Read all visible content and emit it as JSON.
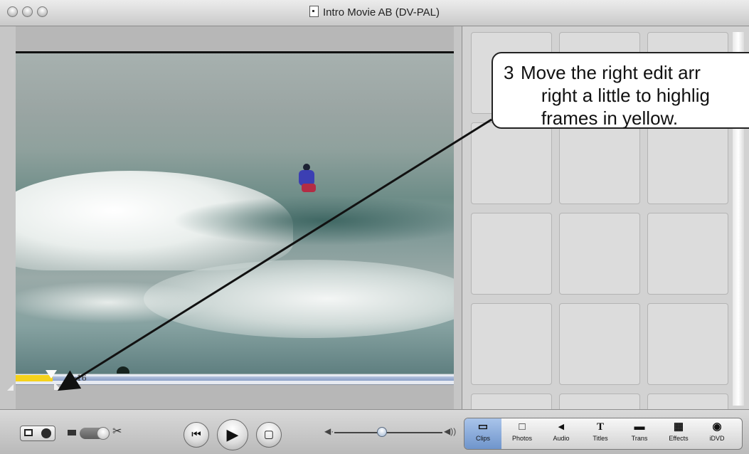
{
  "window": {
    "title": "Intro Movie AB (DV-PAL)"
  },
  "viewer": {
    "timecode": "0:16"
  },
  "callout": {
    "number": "3",
    "line1": "Move the right edit arr",
    "line2": "right a little to highlig",
    "line3": "frames in yellow."
  },
  "icons": {
    "scissors": "✂",
    "rewind": "⏮",
    "play": "▶",
    "fullscreen": "▢",
    "vol_low": "◀·",
    "vol_high": "◀))"
  },
  "panes": [
    {
      "label": "Clips",
      "icon": "▭"
    },
    {
      "label": "Photos",
      "icon": "□"
    },
    {
      "label": "Audio",
      "icon": "◂"
    },
    {
      "label": "Titles",
      "icon": "T"
    },
    {
      "label": "Trans",
      "icon": "▬"
    },
    {
      "label": "Effects",
      "icon": "▦"
    },
    {
      "label": "iDVD",
      "icon": "◉"
    }
  ],
  "colors": {
    "selection_yellow": "#f5d21c",
    "selected_pane": "#8fb0de",
    "callout_border": "#222222"
  }
}
